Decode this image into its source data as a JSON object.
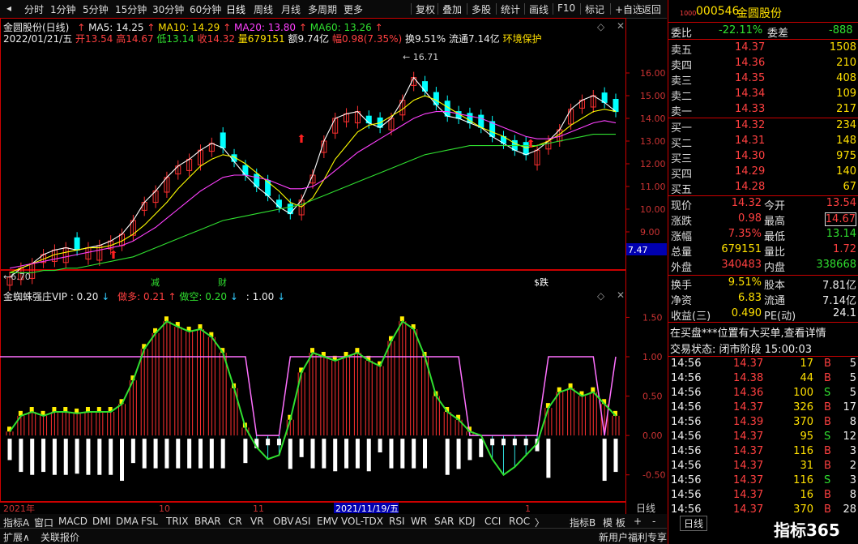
{
  "toolbar": {
    "periods": [
      "分时",
      "1分钟",
      "5分钟",
      "15分钟",
      "30分钟",
      "60分钟",
      "日线",
      "周线",
      "月线",
      "多周期",
      "更多"
    ],
    "active": "日线",
    "more_arrow": "〉",
    "actions": [
      "复权",
      "叠加",
      "多股",
      "统计",
      "画线",
      "F10",
      "标记",
      "+自选",
      "返回"
    ]
  },
  "kline": {
    "title": "金圆股份(日线)",
    "ma5": "MA5: 14.25",
    "ma10": "MA10: 14.29",
    "ma20": "MA20: 13.80",
    "ma60": "MA60: 13.26",
    "info_date": "2022/01/21/五",
    "info_open": "开13.54",
    "info_high": "高14.67",
    "info_low": "低13.14",
    "info_close": "收14.32",
    "info_vol": "量679151",
    "info_amt": "额9.74亿",
    "info_pct": "幅0.98(7.35%)",
    "info_turnover": "换9.51%",
    "info_float": "流通7.14亿",
    "info_tag": "环境保护",
    "high_mark": "16.71",
    "low_mark": "6.70",
    "price_box": "7.47",
    "event_marks": [
      "减",
      "财",
      "$跌"
    ],
    "colors": {
      "ma5": "#ffffff",
      "ma10": "#ffff00",
      "ma20": "#ff40ff",
      "ma60": "#30e030",
      "up": "#ff3030",
      "down": "#00ffff"
    }
  },
  "indicator": {
    "title": "金蜘蛛强庄VIP",
    "v1": ": 0.20",
    "buy": "做多: 0.21",
    "sell": "做空: 0.20",
    "v2": ": 1.00"
  },
  "chart_data": {
    "type": "line",
    "title": "",
    "xlabel": "",
    "ylabel": "",
    "x_ticks": [
      "2021年",
      "10",
      "11",
      "2021/11/19/五",
      "1"
    ],
    "price_ticks": [
      9.0,
      10.0,
      11.0,
      12.0,
      13.0,
      14.0,
      15.0,
      16.0
    ],
    "ylim": [
      7.0,
      17.0
    ],
    "indicator_ticks": [
      -0.5,
      0.0,
      0.5,
      1.0,
      1.5
    ],
    "indicator_ylim": [
      -0.75,
      1.7
    ],
    "series": [
      {
        "name": "MA5",
        "values": [
          7.0,
          7.4,
          7.6,
          8.0,
          8.2,
          8.3,
          8.2,
          8.3,
          8.4,
          8.6,
          8.9,
          9.5,
          10.3,
          10.8,
          11.4,
          11.9,
          12.2,
          12.6,
          12.9,
          12.7,
          12.1,
          11.5,
          11.0,
          10.6,
          10.1,
          9.8,
          10.4,
          11.5,
          13.0,
          14.0,
          14.2,
          14.3,
          13.8,
          13.6,
          14.0,
          14.8,
          15.8,
          15.2,
          14.6,
          14.1,
          14.0,
          13.8,
          13.6,
          13.2,
          12.9,
          12.6,
          12.4,
          12.6,
          13.0,
          13.5,
          14.4,
          14.8,
          15.0,
          14.7,
          14.3
        ]
      },
      {
        "name": "MA10",
        "values": [
          7.2,
          7.4,
          7.6,
          7.8,
          8.0,
          8.1,
          8.2,
          8.3,
          8.3,
          8.4,
          8.6,
          8.9,
          9.3,
          9.8,
          10.3,
          10.9,
          11.4,
          11.9,
          12.2,
          12.4,
          12.3,
          12.0,
          11.6,
          11.2,
          10.8,
          10.3,
          10.1,
          10.5,
          11.3,
          12.2,
          12.8,
          13.4,
          13.7,
          13.8,
          14.1,
          14.4,
          14.8,
          15.0,
          14.8,
          14.5,
          14.2,
          13.9,
          13.6,
          13.4,
          13.2,
          12.9,
          12.7,
          12.8,
          13.0,
          13.3,
          13.7,
          14.0,
          14.3,
          14.4,
          14.3
        ]
      },
      {
        "name": "MA20",
        "values": [
          7.4,
          7.5,
          7.6,
          7.7,
          7.8,
          7.9,
          8.0,
          8.1,
          8.2,
          8.3,
          8.4,
          8.6,
          8.9,
          9.2,
          9.6,
          10.0,
          10.4,
          10.8,
          11.1,
          11.4,
          11.5,
          11.5,
          11.4,
          11.3,
          11.1,
          10.9,
          10.9,
          11.0,
          11.3,
          11.7,
          12.1,
          12.5,
          12.8,
          13.1,
          13.4,
          13.7,
          14.0,
          14.2,
          14.3,
          14.3,
          14.2,
          14.1,
          14.0,
          13.8,
          13.6,
          13.4,
          13.2,
          13.1,
          13.1,
          13.2,
          13.4,
          13.6,
          13.8,
          13.9,
          13.8
        ]
      },
      {
        "name": "MA60",
        "values": [
          7.2,
          7.2,
          7.2,
          7.3,
          7.3,
          7.4,
          7.4,
          7.5,
          7.6,
          7.7,
          7.8,
          7.9,
          8.1,
          8.3,
          8.5,
          8.7,
          8.9,
          9.1,
          9.3,
          9.5,
          9.6,
          9.7,
          9.8,
          9.9,
          10.0,
          10.1,
          10.2,
          10.4,
          10.6,
          10.8,
          11.0,
          11.2,
          11.4,
          11.6,
          11.8,
          12.0,
          12.2,
          12.4,
          12.5,
          12.6,
          12.7,
          12.8,
          12.8,
          12.8,
          12.8,
          12.8,
          12.8,
          12.8,
          12.9,
          13.0,
          13.1,
          13.2,
          13.3,
          13.3,
          13.3
        ]
      }
    ],
    "indicator_series": [
      {
        "name": "信号线",
        "values": [
          0.05,
          0.25,
          0.3,
          0.25,
          0.3,
          0.3,
          0.28,
          0.3,
          0.3,
          0.3,
          0.4,
          0.7,
          1.1,
          1.3,
          1.45,
          1.38,
          1.32,
          1.35,
          1.25,
          1.05,
          0.6,
          0.1,
          -0.15,
          -0.3,
          -0.25,
          0.2,
          0.8,
          1.05,
          1.0,
          0.95,
          1.0,
          1.05,
          0.95,
          0.88,
          1.2,
          1.45,
          1.35,
          1.0,
          0.5,
          0.3,
          0.2,
          0.05,
          0.0,
          -0.3,
          -0.5,
          -0.4,
          -0.25,
          -0.1,
          0.35,
          0.55,
          0.6,
          0.5,
          0.55,
          0.4,
          0.25
        ]
      },
      {
        "name": "区间线",
        "values": [
          1.0,
          1.0,
          1.0,
          1.0,
          1.0,
          1.0,
          1.0,
          1.0,
          1.0,
          1.0,
          1.0,
          1.0,
          1.0,
          1.0,
          1.0,
          1.0,
          1.0,
          1.0,
          1.0,
          1.0,
          1.0,
          1.0,
          0.0,
          0.0,
          0.0,
          1.0,
          1.0,
          1.0,
          1.0,
          1.0,
          1.0,
          1.0,
          1.0,
          1.0,
          1.0,
          1.0,
          1.0,
          1.0,
          1.0,
          1.0,
          1.0,
          0.0,
          0.0,
          0.0,
          0.0,
          0.0,
          0.0,
          0.0,
          1.0,
          1.0,
          1.0,
          1.0,
          1.0,
          0.0,
          1.0
        ]
      }
    ]
  },
  "timeaxis": {
    "label": "日线"
  },
  "bottom_tabs": [
    "指标A",
    "窗口",
    "MACD",
    "DMI",
    "DMA",
    "FSL",
    "TRIX",
    "BRAR",
    "CR",
    "VR",
    "OBV",
    "ASI",
    "EMV",
    "VOL-TDX",
    "RSI",
    "WR",
    "SAR",
    "KDJ",
    "CCI",
    "ROC",
    "〉",
    "指标B",
    "模 板",
    "+",
    "-"
  ],
  "bottom_line2": [
    "扩展∧",
    "关联报价"
  ],
  "stock": {
    "code": "000546",
    "name": "金圆股份",
    "code_prefix": "1000"
  },
  "orderbook": {
    "weibi_label": "委比",
    "weibi": "-22.11%",
    "weicha_label": "委差",
    "weicha": "-888",
    "asks": [
      {
        "label": "卖五",
        "price": "14.37",
        "vol": "1508"
      },
      {
        "label": "卖四",
        "price": "14.36",
        "vol": "210"
      },
      {
        "label": "卖三",
        "price": "14.35",
        "vol": "408"
      },
      {
        "label": "卖二",
        "price": "14.34",
        "vol": "109"
      },
      {
        "label": "卖一",
        "price": "14.33",
        "vol": "217"
      }
    ],
    "bids": [
      {
        "label": "买一",
        "price": "14.32",
        "vol": "234"
      },
      {
        "label": "买二",
        "price": "14.31",
        "vol": "148"
      },
      {
        "label": "买三",
        "price": "14.30",
        "vol": "975"
      },
      {
        "label": "买四",
        "price": "14.29",
        "vol": "140"
      },
      {
        "label": "买五",
        "price": "14.28",
        "vol": "67"
      }
    ]
  },
  "quote": {
    "rows": [
      {
        "l1": "现价",
        "v1": "14.32",
        "l2": "今开",
        "v2": "13.54"
      },
      {
        "l1": "涨跌",
        "v1": "0.98",
        "l2": "最高",
        "v2": "14.67"
      },
      {
        "l1": "涨幅",
        "v1": "7.35%",
        "l2": "最低",
        "v2": "13.14"
      },
      {
        "l1": "总量",
        "v1": "679151",
        "l2": "量比",
        "v2": "1.72"
      },
      {
        "l1": "外盘",
        "v1": "340483",
        "l2": "内盘",
        "v2": "338668"
      }
    ],
    "rows2": [
      {
        "l1": "换手",
        "v1": "9.51%",
        "l2": "股本",
        "v2": "7.81亿"
      },
      {
        "l1": "净资",
        "v1": "6.83",
        "l2": "流通",
        "v2": "7.14亿"
      },
      {
        "l1": "收益(三)",
        "v1": "0.490",
        "l2": "PE(动)",
        "v2": "24.1"
      }
    ],
    "notice": "在买盘***位置有大买单,查看详情",
    "status": "交易状态: 闭市阶段 15:00:03"
  },
  "ticks": [
    {
      "t": "14:56",
      "p": "14.37",
      "v": "17",
      "d": "B",
      "n": "5"
    },
    {
      "t": "14:56",
      "p": "14.38",
      "v": "44",
      "d": "B",
      "n": "5"
    },
    {
      "t": "14:56",
      "p": "14.36",
      "v": "100",
      "d": "S",
      "n": "5"
    },
    {
      "t": "14:56",
      "p": "14.37",
      "v": "326",
      "d": "B",
      "n": "17"
    },
    {
      "t": "14:56",
      "p": "14.39",
      "v": "370",
      "d": "B",
      "n": "8"
    },
    {
      "t": "14:56",
      "p": "14.37",
      "v": "95",
      "d": "S",
      "n": "12"
    },
    {
      "t": "14:56",
      "p": "14.37",
      "v": "116",
      "d": "B",
      "n": "3"
    },
    {
      "t": "14:56",
      "p": "14.37",
      "v": "31",
      "d": "B",
      "n": "2"
    },
    {
      "t": "14:56",
      "p": "14.37",
      "v": "116",
      "d": "S",
      "n": "3"
    },
    {
      "t": "14:56",
      "p": "14.37",
      "v": "16",
      "d": "B",
      "n": "8"
    },
    {
      "t": "14:56",
      "p": "14.37",
      "v": "370",
      "d": "B",
      "n": "28"
    }
  ],
  "rpanel_bottom": {
    "tab": "日线",
    "promo": "新用户福利专享",
    "watermark": "指标365"
  }
}
